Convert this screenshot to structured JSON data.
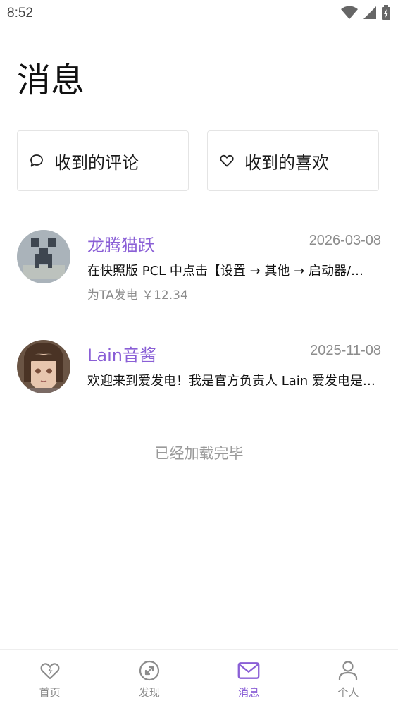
{
  "status_bar": {
    "time": "8:52"
  },
  "page": {
    "title": "消息"
  },
  "actions": [
    {
      "label": "收到的评论",
      "icon": "comment-icon"
    },
    {
      "label": "收到的喜欢",
      "icon": "heart-icon"
    }
  ],
  "messages": [
    {
      "name": "龙腾猫跃",
      "date": "2026-03-08",
      "preview": "在快照版 PCL 中点击【设置 → 其他 → 启动器/…",
      "sub": "为TA发电 ￥12.34",
      "avatar": "creeper-avatar"
    },
    {
      "name": "Lain音酱",
      "date": "2025-11-08",
      "preview": "欢迎来到爱发电！我是官方负责人 Lain 爱发电是…",
      "sub": "",
      "avatar": "anime-girl-avatar"
    }
  ],
  "list_end_text": "已经加载完毕",
  "tabs": [
    {
      "label": "首页",
      "icon": "home-heart-icon",
      "active": false
    },
    {
      "label": "发现",
      "icon": "compass-icon",
      "active": false
    },
    {
      "label": "消息",
      "icon": "mail-icon",
      "active": true
    },
    {
      "label": "个人",
      "icon": "person-icon",
      "active": false
    }
  ],
  "colors": {
    "accent": "#8a5fd6",
    "muted_text": "#8c8c8c",
    "card_border": "#e4e4e4"
  }
}
